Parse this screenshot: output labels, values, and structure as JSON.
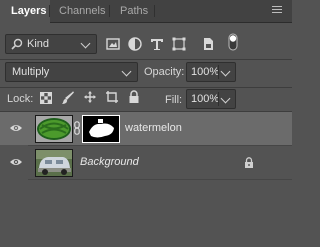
{
  "tabs": [
    {
      "label": "Layers",
      "active": true
    },
    {
      "label": "Channels",
      "active": false
    },
    {
      "label": "Paths",
      "active": false
    }
  ],
  "filter": {
    "kind_label": "Kind",
    "icons": [
      "pixel-filter-icon",
      "adjustment-filter-icon",
      "type-filter-icon",
      "shape-filter-icon",
      "smart-object-filter-icon",
      "filter-toggle-icon"
    ]
  },
  "blend": {
    "mode": "Multiply",
    "opacity_label": "Opacity:",
    "opacity_value": "100%"
  },
  "lock": {
    "label": "Lock:",
    "icons": [
      "lock-transparent-icon",
      "lock-image-icon",
      "lock-position-icon",
      "lock-artboard-icon",
      "lock-all-icon"
    ],
    "fill_label": "Fill:",
    "fill_value": "100%"
  },
  "layers": [
    {
      "name": "watermelon",
      "visible": true,
      "selected": true,
      "has_mask": true,
      "locked": false,
      "italic": false
    },
    {
      "name": "Background",
      "visible": true,
      "selected": false,
      "has_mask": false,
      "locked": true,
      "italic": true
    }
  ],
  "colors": {
    "panel_bg": "#535353",
    "tabbar_bg": "#424242",
    "selected_row": "#6b6b6b"
  }
}
